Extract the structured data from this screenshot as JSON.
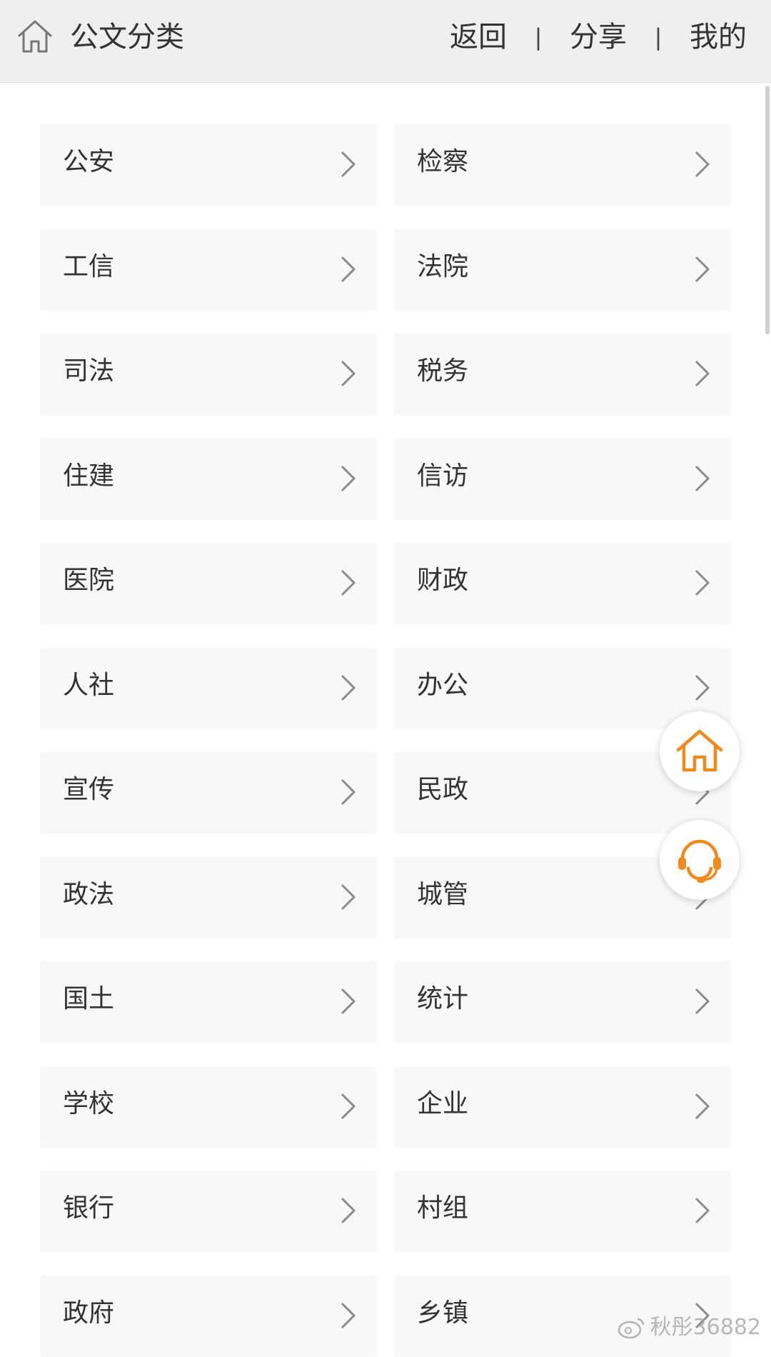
{
  "header": {
    "title": "公文分类",
    "nav": {
      "back": "返回",
      "share": "分享",
      "mine": "我的",
      "separator": "|"
    }
  },
  "categories": [
    {
      "left": "公安",
      "right": "检察"
    },
    {
      "left": "工信",
      "right": "法院"
    },
    {
      "left": "司法",
      "right": "税务"
    },
    {
      "left": "住建",
      "right": "信访"
    },
    {
      "left": "医院",
      "right": "财政"
    },
    {
      "left": "人社",
      "right": "办公"
    },
    {
      "left": "宣传",
      "right": "民政"
    },
    {
      "left": "政法",
      "right": "城管"
    },
    {
      "left": "国土",
      "right": "统计"
    },
    {
      "left": "学校",
      "right": "企业"
    },
    {
      "left": "银行",
      "right": "村组"
    },
    {
      "left": "政府",
      "right": "乡镇"
    }
  ],
  "icons": {
    "header_home": "home-icon",
    "arrow": "chevron-right-icon",
    "float_home": "home-icon",
    "float_service": "customer-service-icon",
    "watermark": "weibo-icon"
  },
  "colors": {
    "accent": "#f08a1c",
    "header_bg": "#efefef",
    "cell_bg": "#f8f8f8"
  },
  "watermark": {
    "text": "秋彤36882"
  }
}
